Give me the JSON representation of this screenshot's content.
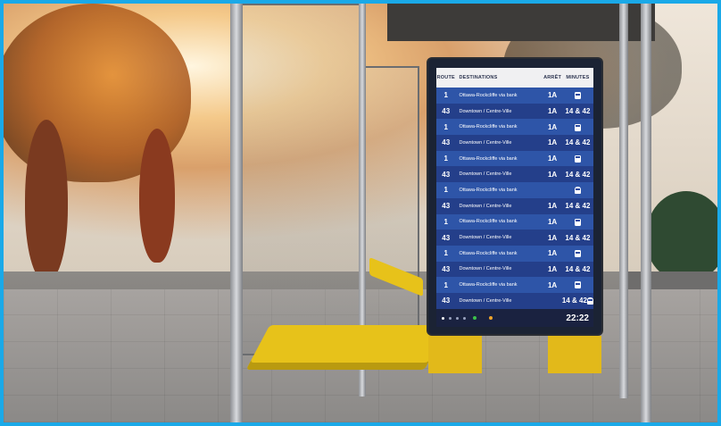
{
  "display": {
    "headers": {
      "route": "ROUTE",
      "destinations": "DESTINATIONS",
      "stop": "ARRÊT",
      "minutes": "MINUTES"
    },
    "rows": [
      {
        "route": "1",
        "destination": "Ottawa-Rockcliffe via bank",
        "stop": "1A",
        "minutes": "",
        "icon": "bus-icon"
      },
      {
        "route": "43",
        "destination": "Downtown / Centre-Ville",
        "stop": "1A",
        "minutes": "14 & 42",
        "icon": ""
      },
      {
        "route": "1",
        "destination": "Ottawa-Rockcliffe via bank",
        "stop": "1A",
        "minutes": "",
        "icon": "bus-icon"
      },
      {
        "route": "43",
        "destination": "Downtown / Centre-Ville",
        "stop": "1A",
        "minutes": "14 & 42",
        "icon": ""
      },
      {
        "route": "1",
        "destination": "Ottawa-Rockcliffe via bank",
        "stop": "1A",
        "minutes": "",
        "icon": "bus-icon"
      },
      {
        "route": "43",
        "destination": "Downtown / Centre-Ville",
        "stop": "1A",
        "minutes": "14 & 42",
        "icon": ""
      },
      {
        "route": "1",
        "destination": "Ottawa-Rockcliffe via bank",
        "stop": "",
        "minutes": "",
        "icon": "train-icon"
      },
      {
        "route": "43",
        "destination": "Downtown / Centre-Ville",
        "stop": "1A",
        "minutes": "14 & 42",
        "icon": ""
      },
      {
        "route": "1",
        "destination": "Ottawa-Rockcliffe via bank",
        "stop": "1A",
        "minutes": "",
        "icon": "bus-icon"
      },
      {
        "route": "43",
        "destination": "Downtown / Centre-Ville",
        "stop": "1A",
        "minutes": "14 & 42",
        "icon": ""
      },
      {
        "route": "1",
        "destination": "Ottawa-Rockcliffe via bank",
        "stop": "1A",
        "minutes": "",
        "icon": "bus-icon"
      },
      {
        "route": "43",
        "destination": "Downtown / Centre-Ville",
        "stop": "1A",
        "minutes": "14 & 42",
        "icon": ""
      },
      {
        "route": "1",
        "destination": "Ottawa-Rockcliffe via bank",
        "stop": "1A",
        "minutes": "",
        "icon": "bus-icon"
      },
      {
        "route": "43",
        "destination": "Downtown / Centre-Ville",
        "stop": "",
        "minutes": "14 & 42",
        "icon": "train-icon"
      }
    ],
    "clock": "22:22",
    "pager_dots": 4,
    "active_dot": 0,
    "colors": {
      "row_light": "#2e55a8",
      "row_dark": "#243f8a",
      "legend_green": "#3cc24a",
      "legend_orange": "#f1a52b"
    }
  }
}
